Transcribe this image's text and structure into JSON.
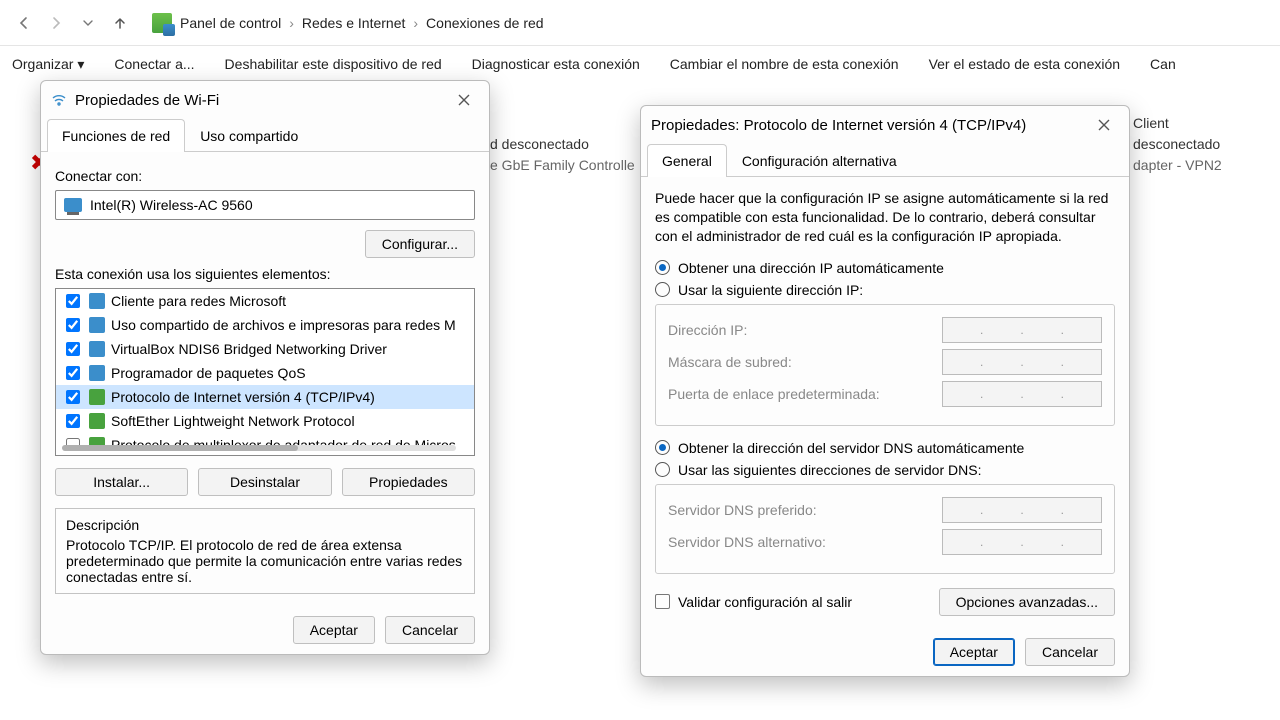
{
  "nav": {
    "breadcrumb": [
      "Panel de control",
      "Redes e Internet",
      "Conexiones de red"
    ]
  },
  "toolbar": {
    "organize": "Organizar",
    "connect": "Conectar a...",
    "disable": "Deshabilitar este dispositivo de red",
    "diagnose": "Diagnosticar esta conexión",
    "rename": "Cambiar el nombre de esta conexión",
    "status": "Ver el estado de esta conexión",
    "more": "Can"
  },
  "bg": {
    "f1a": "d desconectado",
    "f1b": "e GbE Family Controlle",
    "f2a": "Client",
    "f2b": "desconectado",
    "f2c": "dapter - VPN2"
  },
  "wifi": {
    "title": "Propiedades de Wi-Fi",
    "tab1": "Funciones de red",
    "tab2": "Uso compartido",
    "connectWith": "Conectar con:",
    "adapter": "Intel(R) Wireless-AC 9560",
    "configure": "Configurar...",
    "elementsLabel": "Esta conexión usa los siguientes elementos:",
    "items": [
      {
        "label": "Cliente para redes Microsoft",
        "checked": true
      },
      {
        "label": "Uso compartido de archivos e impresoras para redes M",
        "checked": true
      },
      {
        "label": "VirtualBox NDIS6 Bridged Networking Driver",
        "checked": true
      },
      {
        "label": "Programador de paquetes QoS",
        "checked": true
      },
      {
        "label": "Protocolo de Internet versión 4 (TCP/IPv4)",
        "checked": true,
        "selected": true
      },
      {
        "label": "SoftEther Lightweight Network Protocol",
        "checked": true
      },
      {
        "label": "Protocolo de multiplexor de adaptador de red de Micros",
        "checked": false
      }
    ],
    "install": "Instalar...",
    "uninstall": "Desinstalar",
    "properties": "Propiedades",
    "descTitle": "Descripción",
    "descText": "Protocolo TCP/IP. El protocolo de red de área extensa predeterminado que permite la comunicación entre varias redes conectadas entre sí.",
    "ok": "Aceptar",
    "cancel": "Cancelar"
  },
  "ipv4": {
    "title": "Propiedades: Protocolo de Internet versión 4 (TCP/IPv4)",
    "tab1": "General",
    "tab2": "Configuración alternativa",
    "intro": "Puede hacer que la configuración IP se asigne automáticamente si la red es compatible con esta funcionalidad. De lo contrario, deberá consultar con el administrador de red cuál es la configuración IP apropiada.",
    "autoIp": "Obtener una dirección IP automáticamente",
    "manualIp": "Usar la siguiente dirección IP:",
    "ipAddr": "Dirección IP:",
    "mask": "Máscara de subred:",
    "gateway": "Puerta de enlace predeterminada:",
    "autoDns": "Obtener la dirección del servidor DNS automáticamente",
    "manualDns": "Usar las siguientes direcciones de servidor DNS:",
    "dns1": "Servidor DNS preferido:",
    "dns2": "Servidor DNS alternativo:",
    "validate": "Validar configuración al salir",
    "advanced": "Opciones avanzadas...",
    "ok": "Aceptar",
    "cancel": "Cancelar"
  }
}
